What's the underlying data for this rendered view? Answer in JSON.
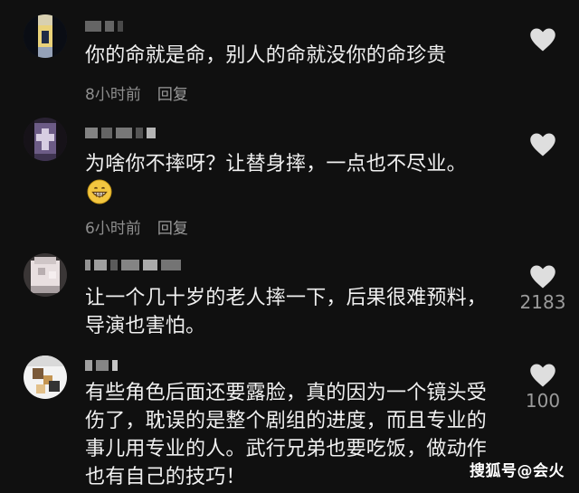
{
  "comments": [
    {
      "text": "你的命就是命，别人的命就没你的命珍贵",
      "time": "8小时前",
      "reply": "回复",
      "likes": ""
    },
    {
      "text": "为啥你不摔呀？让替身摔，一点也不尽业。",
      "emoji": "grinning-face",
      "time": "6小时前",
      "reply": "回复",
      "likes": ""
    },
    {
      "text": "让一个几十岁的老人摔一下，后果很难预料，\n导演也害怕。",
      "time": "",
      "reply": "",
      "likes": "2183"
    },
    {
      "text": "有些角色后面还要露脸，真的因为一个镜头受\n伤了，耽误的是整个剧组的进度，而且专业的\n事儿用专业的人。武行兄弟也要吃饭，做动作\n也有自己的技巧！",
      "time": "",
      "reply": "",
      "likes": "100"
    }
  ],
  "watermark": "搜狐号@会火",
  "colors": {
    "background": "#101010",
    "text": "#f0f0f0",
    "meta": "#8e8e8e",
    "heart": "#dedede"
  }
}
